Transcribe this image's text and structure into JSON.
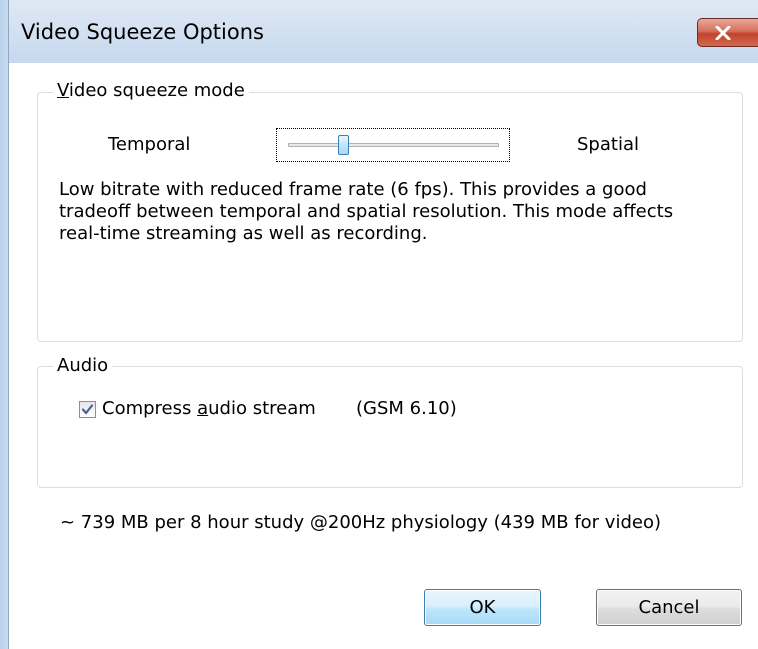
{
  "window": {
    "title": "Video Squeeze Options",
    "close_icon": "close-x-icon"
  },
  "video_group": {
    "legend_accesskey": "V",
    "legend_rest": "ideo squeeze mode",
    "left_label": "Temporal",
    "right_label": "Spatial",
    "slider_position_fraction": 0.25,
    "description": "Low bitrate with reduced frame rate (6 fps). This provides a good tradeoff between temporal and spatial resolution. This mode affects real-time streaming as well as recording."
  },
  "audio_group": {
    "legend": "Audio",
    "compress_checked": true,
    "compress_label_before": "Compress ",
    "compress_label_accesskey": "a",
    "compress_label_after": "udio stream",
    "codec": "(GSM 6.10)"
  },
  "size_estimate": "~ 739 MB per 8 hour study @200Hz physiology (439 MB for video)",
  "buttons": {
    "ok": "OK",
    "cancel": "Cancel"
  },
  "colors": {
    "titlebar": "#c6d8ee",
    "close_button": "#c2432b",
    "default_button_border": "#3c7fb1"
  }
}
